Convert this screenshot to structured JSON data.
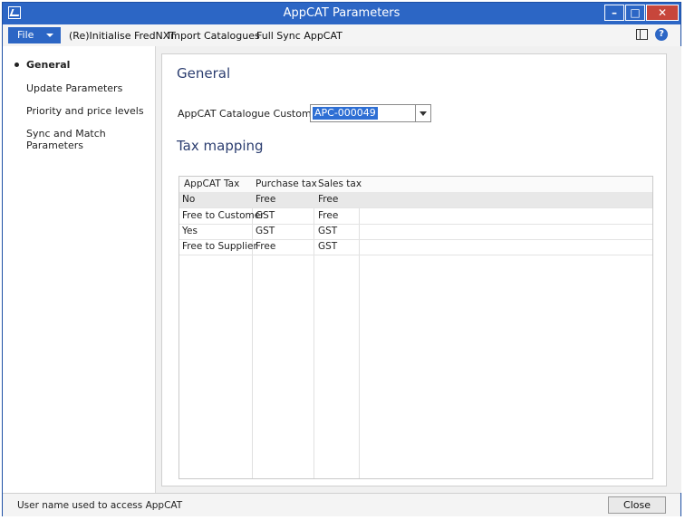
{
  "window": {
    "title": "AppCAT Parameters"
  },
  "menubar": {
    "file_label": "File",
    "items": [
      "(Re)Initialise FredNXT",
      "Import Catalogues",
      "Full Sync AppCAT"
    ]
  },
  "sidebar": {
    "items": [
      {
        "label": "General",
        "active": true
      },
      {
        "label": "Update Parameters",
        "active": false
      },
      {
        "label": "Priority and price levels",
        "active": false
      },
      {
        "label": "Sync and Match Parameters",
        "active": false
      }
    ]
  },
  "general": {
    "title": "General",
    "customer_id_label": "AppCAT Catalogue Customer ID:",
    "customer_id_value": "APC-000049"
  },
  "tax_mapping": {
    "title": "Tax mapping",
    "columns": [
      "AppCAT Tax",
      "Purchase tax",
      "Sales tax"
    ],
    "rows": [
      [
        "No",
        "Free",
        "Free"
      ],
      [
        "Free to Customer",
        "GST",
        "Free"
      ],
      [
        "Yes",
        "GST",
        "GST"
      ],
      [
        "Free to Supplier",
        "Free",
        "GST"
      ]
    ]
  },
  "statusbar": {
    "text": "User name used to access AppCAT",
    "close_label": "Close"
  },
  "colors": {
    "accent": "#2c66c5",
    "close": "#c7463b",
    "heading": "#2c3e70"
  }
}
